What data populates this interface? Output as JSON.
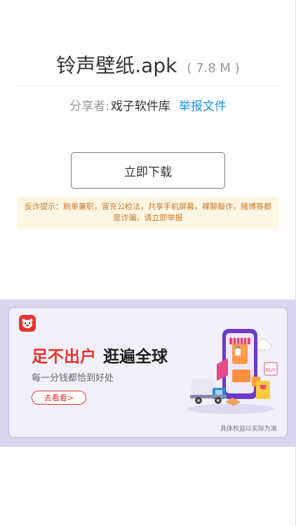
{
  "file": {
    "name": "铃声壁纸.apk",
    "size": "( 7.8 M )"
  },
  "sharer": {
    "label": "分享者:",
    "name": "戏子软件库",
    "report": "举报文件"
  },
  "download": {
    "label": "立即下载"
  },
  "warning": {
    "text": "反诈提示：刷单兼职，冒充公检法，共享手机屏幕，裸聊敲诈，赌博等都是诈骗，请立即举报"
  },
  "ad": {
    "headline_part1": "足不出户",
    "headline_part2": "逛遍全球",
    "subtitle": "每一分钱都恰到好处",
    "button": "去看看>",
    "disclaimer": "具体权益以实际为准",
    "illustration_tag": "BUY",
    "colors": {
      "brand": "#e9322d",
      "panel_bg": "#d9d5ee",
      "card_bg": "#f1f0fb"
    },
    "icons": [
      "brand-logo-icon",
      "shopping-phone-illustration"
    ]
  },
  "colors": {
    "link": "#1890ff",
    "warning_text": "#c8792c",
    "warning_bg": "#fdf6e3"
  }
}
